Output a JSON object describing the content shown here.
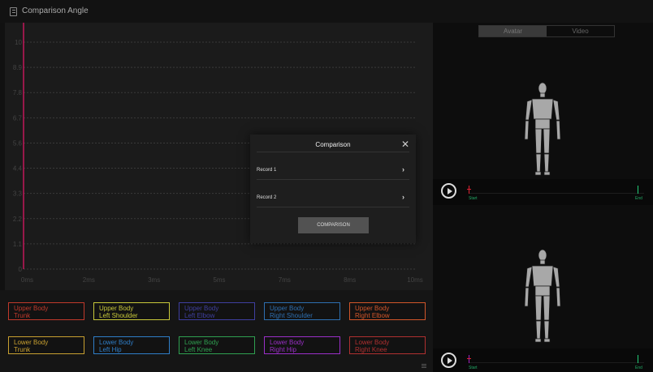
{
  "window": {
    "title": "Comparison Angle"
  },
  "chart_data": {
    "type": "line",
    "x_ticks": [
      "0ms",
      "2ms",
      "3ms",
      "5ms",
      "7ms",
      "8ms",
      "10ms"
    ],
    "y_ticks": [
      "0",
      "1.1",
      "2.2",
      "3.3",
      "4.4",
      "5.6",
      "6.7",
      "7.8",
      "8.9",
      "10"
    ],
    "ylim": [
      0,
      10
    ],
    "grid": true,
    "cursor_x": 0,
    "cursor_color": "#c2185b",
    "series": []
  },
  "legend": {
    "items": [
      {
        "line1": "Upper Body",
        "line2": "Trunk",
        "color": "#c0392b"
      },
      {
        "line1": "Upper Body",
        "line2": "Left Shoulder",
        "color": "#c8c83a"
      },
      {
        "line1": "Upper Body",
        "line2": "Left Elbow",
        "color": "#3f3fa0"
      },
      {
        "line1": "Upper Body",
        "line2": "Right Shoulder",
        "color": "#2e6fb0"
      },
      {
        "line1": "Upper Body",
        "line2": "Right Elbow",
        "color": "#d2562a"
      },
      {
        "line1": "Lower Body",
        "line2": "Trunk",
        "color": "#c8a030"
      },
      {
        "line1": "Lower Body",
        "line2": "Left Hip",
        "color": "#2f7ec8"
      },
      {
        "line1": "Lower Body",
        "line2": "Left Knee",
        "color": "#2fa050"
      },
      {
        "line1": "Lower Body",
        "line2": "Right Hip",
        "color": "#9b2fc8"
      },
      {
        "line1": "Lower Body",
        "line2": "Right Knee",
        "color": "#b03030"
      }
    ]
  },
  "view_toggle": {
    "options": [
      "Avatar",
      "Video"
    ],
    "selected": "Avatar"
  },
  "players": [
    {
      "start_label": "Start",
      "end_label": "End",
      "start_color": "#dd2233"
    },
    {
      "start_label": "Start",
      "end_label": "End",
      "start_color": "#a020c0"
    }
  ],
  "modal": {
    "title": "Comparison",
    "rows": [
      {
        "label": "Record 1"
      },
      {
        "label": "Record 2"
      }
    ],
    "button": "COMPARISON"
  }
}
